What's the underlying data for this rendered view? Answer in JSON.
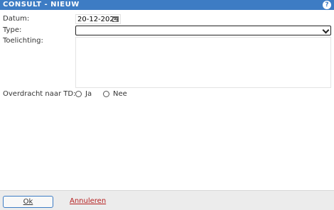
{
  "window": {
    "title": "CONSULT - NIEUW",
    "help_icon": "?"
  },
  "form": {
    "date": {
      "label": "Datum:",
      "value": "20-12-2024",
      "icon": "calendar-icon"
    },
    "type": {
      "label": "Type:",
      "value": "",
      "icon": "chevron-down-icon"
    },
    "notes": {
      "label": "Toelichting:",
      "value": ""
    },
    "transfer": {
      "label": "Overdracht naar TD:",
      "options": [
        "Ja",
        "Nee"
      ],
      "selected": null
    }
  },
  "footer": {
    "ok_label": "Ok",
    "cancel_label": "Annuleren"
  },
  "colors": {
    "accent": "#3d7cc4",
    "cancel": "#b41e1e",
    "footer_bg": "#ececec"
  }
}
